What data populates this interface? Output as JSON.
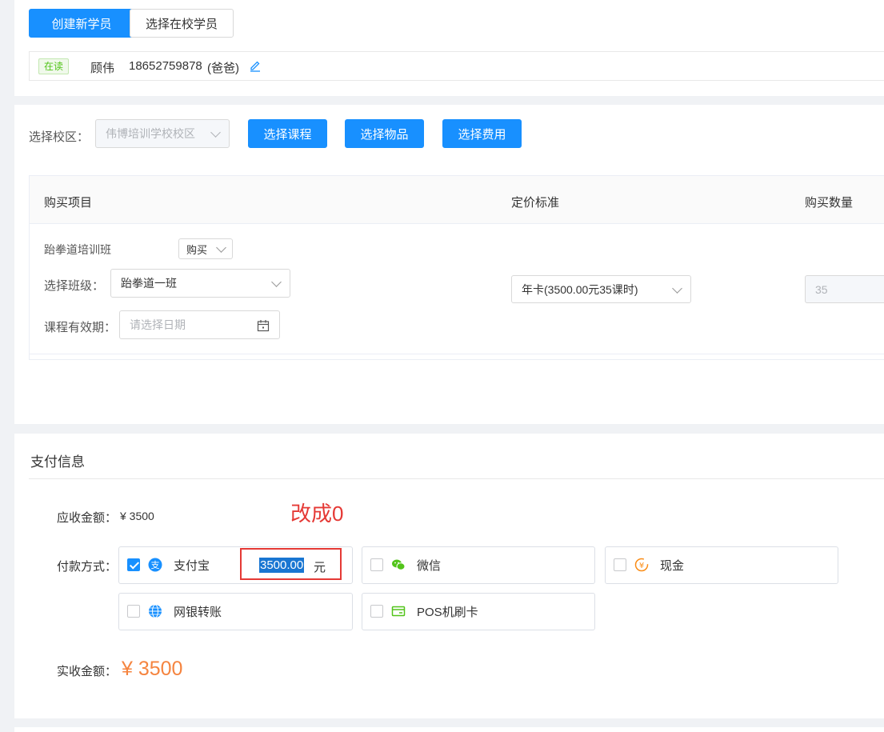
{
  "top": {
    "create_btn": "创建新学员",
    "select_btn": "选择在校学员",
    "student": {
      "status": "在读",
      "name": "顾伟",
      "phone": "18652759878",
      "relation": "(爸爸)"
    }
  },
  "order": {
    "campus_label": "选择校区：",
    "campus_value": "伟博培训学校校区",
    "btn_course": "选择课程",
    "btn_goods": "选择物品",
    "btn_fee": "选择费用",
    "columns": [
      "购买项目",
      "定价标准",
      "购买数量"
    ],
    "row": {
      "course_name": "跆拳道培训班",
      "buy_type": "购买",
      "class_label": "选择班级：",
      "class_value": "跆拳道一班",
      "validity_label": "课程有效期：",
      "validity_placeholder": "请选择日期",
      "price_value": "年卡(3500.00元35课时)",
      "quantity": "35"
    }
  },
  "payment": {
    "section_title": "支付信息",
    "receivable_label": "应收金额：",
    "receivable_value": "¥ 3500",
    "annotation": "改成0",
    "method_label": "付款方式：",
    "methods": [
      {
        "name": "支付宝",
        "checked": true,
        "amount": "3500.00",
        "unit": "元",
        "color": "#1890ff",
        "icon": "alipay-icon"
      },
      {
        "name": "微信",
        "checked": false,
        "color": "#52c41a",
        "icon": "wechat-icon"
      },
      {
        "name": "现金",
        "checked": false,
        "color": "#fa8c16",
        "icon": "cash-icon"
      },
      {
        "name": "网银转账",
        "checked": false,
        "color": "#1890ff",
        "icon": "globe-icon"
      },
      {
        "name": "POS机刷卡",
        "checked": false,
        "color": "#52c41a",
        "icon": "card-icon"
      }
    ],
    "actual_label": "实收金额：",
    "actual_value": "¥ 3500"
  },
  "colors": {
    "primary": "#1890ff",
    "accent_orange": "#f5843f",
    "annotation_red": "#e53935",
    "tag_green": "#52c41a"
  }
}
